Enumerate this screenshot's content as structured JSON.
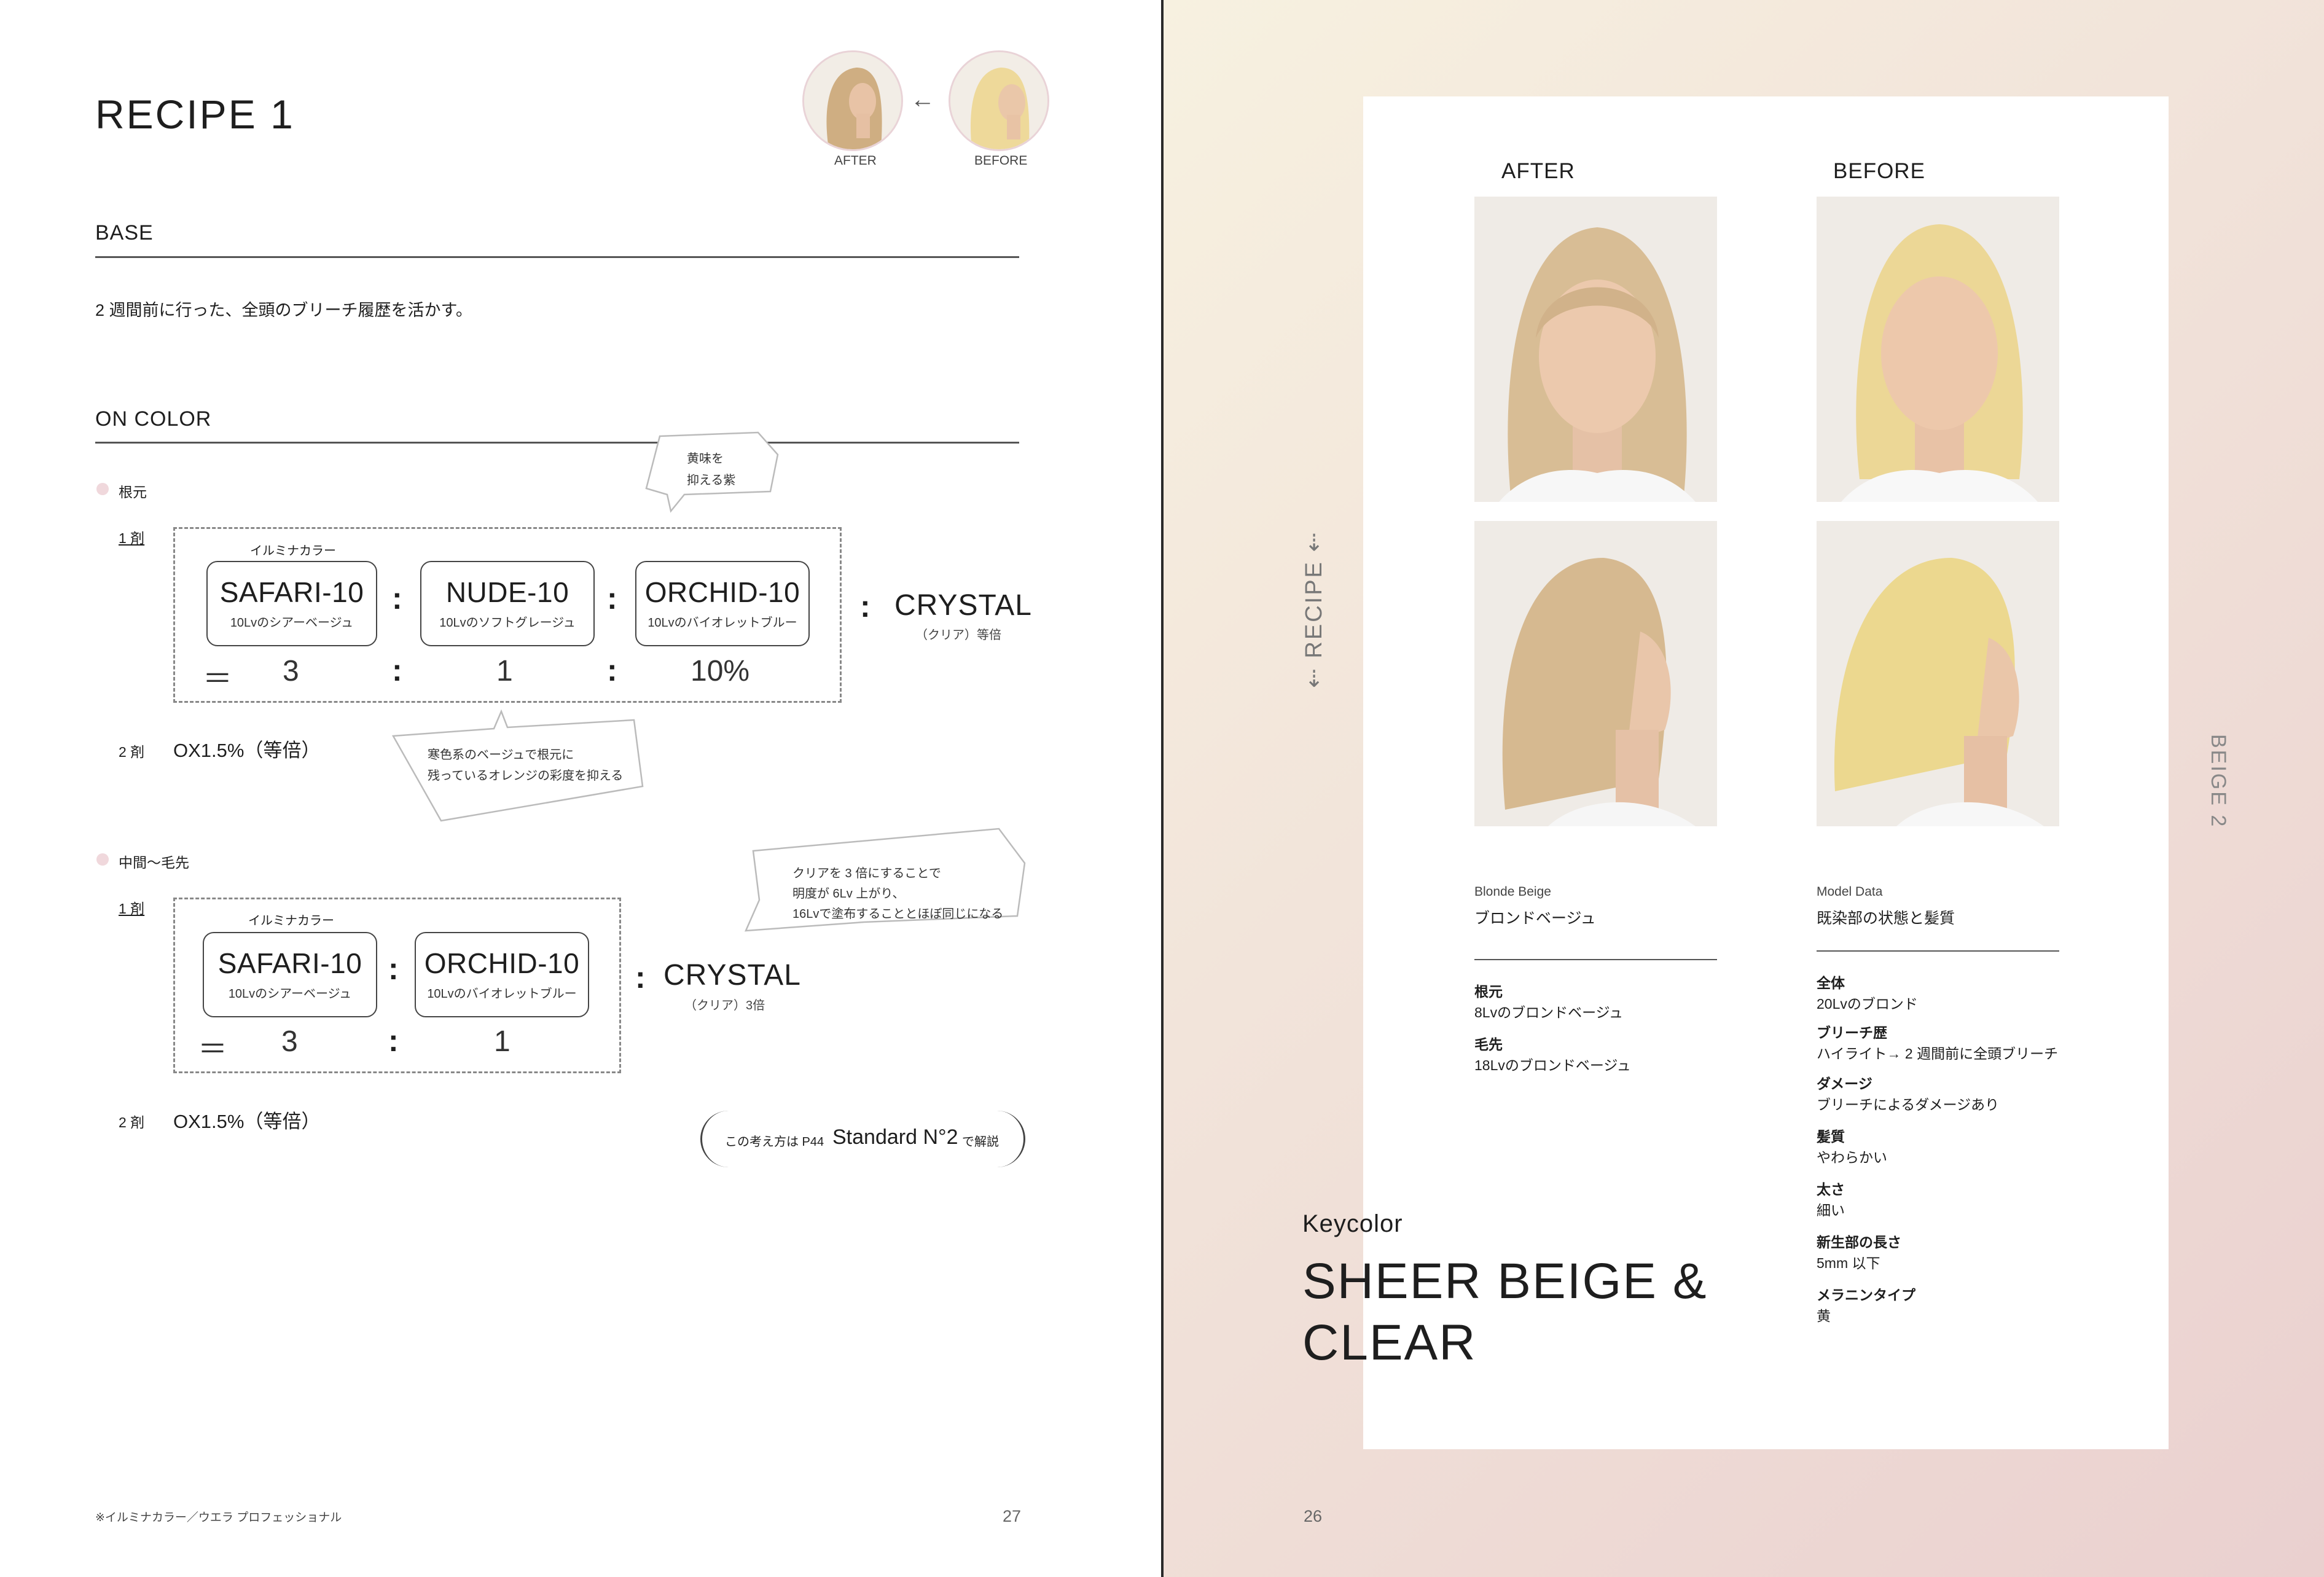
{
  "left": {
    "title": "RECIPE 1",
    "thumb_after": "AFTER",
    "thumb_before": "BEFORE",
    "base": {
      "heading": "BASE",
      "text": "2 週間前に行った、全頭のブリーチ履歴を活かす。"
    },
    "on_color": {
      "heading": "ON COLOR",
      "root": {
        "label": "根元",
        "agent1_label": "1 剤",
        "brand": "イルミナカラー",
        "colors": [
          {
            "name": "SAFARI-10",
            "sub": "10Lvのシアーベージュ"
          },
          {
            "name": "NUDE-10",
            "sub": "10Lvのソフトグレージュ"
          },
          {
            "name": "ORCHID-10",
            "sub": "10Lvのバイオレットブルー"
          }
        ],
        "equals": "＝",
        "ratios": [
          "3",
          "1",
          "10%"
        ],
        "crystal": "CRYSTAL",
        "crystal_sub": "（クリア）等倍",
        "agent2_label": "2 剤",
        "agent2_value": "OX1.5%（等倍）",
        "note_purple_1": "黄味を",
        "note_purple_2": "抑える紫",
        "note_orange_1": "寒色系のベージュで根元に",
        "note_orange_2": "残っているオレンジの彩度を抑える"
      },
      "mid": {
        "label": "中間〜毛先",
        "agent1_label": "1 剤",
        "brand": "イルミナカラー",
        "colors": [
          {
            "name": "SAFARI-10",
            "sub": "10Lvのシアーベージュ"
          },
          {
            "name": "ORCHID-10",
            "sub": "10Lvのバイオレットブルー"
          }
        ],
        "equals": "＝",
        "ratios": [
          "3",
          "1"
        ],
        "crystal": "CRYSTAL",
        "crystal_sub": "（クリア）3倍",
        "agent2_label": "2 剤",
        "agent2_value": "OX1.5%（等倍）",
        "note_1": "クリアを 3 倍にすることで",
        "note_2": "明度が 6Lv 上がり、",
        "note_3": "16Lvで塗布することとほぼ同じになる"
      },
      "reference": {
        "prefix": "この考え方は P44",
        "main": "Standard N°2",
        "suffix": "で解説"
      }
    },
    "footnote": "※イルミナカラー／ウエラ プロフェッショナル",
    "page_number": "27"
  },
  "right": {
    "after": "AFTER",
    "before": "BEFORE",
    "side_left": "RECIPE",
    "side_right": "BEIGE 2",
    "color_info": {
      "en": "Blonde Beige",
      "jp": "ブロンドベージュ",
      "items": [
        {
          "label": "根元",
          "value": "8Lvのブロンドベージュ"
        },
        {
          "label": "毛先",
          "value": "18Lvのブロンドベージュ"
        }
      ]
    },
    "model_info": {
      "en": "Model Data",
      "jp": "既染部の状態と髪質",
      "items": [
        {
          "label": "全体",
          "value": "20Lvのブロンド"
        },
        {
          "label": "ブリーチ歴",
          "value": "ハイライト→ 2 週間前に全頭ブリーチ"
        },
        {
          "label": "ダメージ",
          "value": "ブリーチによるダメージあり"
        },
        {
          "label": "髪質",
          "value": "やわらかい"
        },
        {
          "label": "太さ",
          "value": "細い"
        },
        {
          "label": "新生部の長さ",
          "value": "5mm 以下"
        },
        {
          "label": "メラニンタイプ",
          "value": "黄"
        }
      ]
    },
    "keycolor_label": "Keycolor",
    "keycolor_line1": "SHEER BEIGE &",
    "keycolor_line2": "CLEAR",
    "page_number": "26"
  },
  "colors": {
    "dot_pink": "#f0d8dc",
    "rule": "#555555",
    "gradient_start": "#f7f1e0",
    "gradient_end": "#ead0cf"
  }
}
